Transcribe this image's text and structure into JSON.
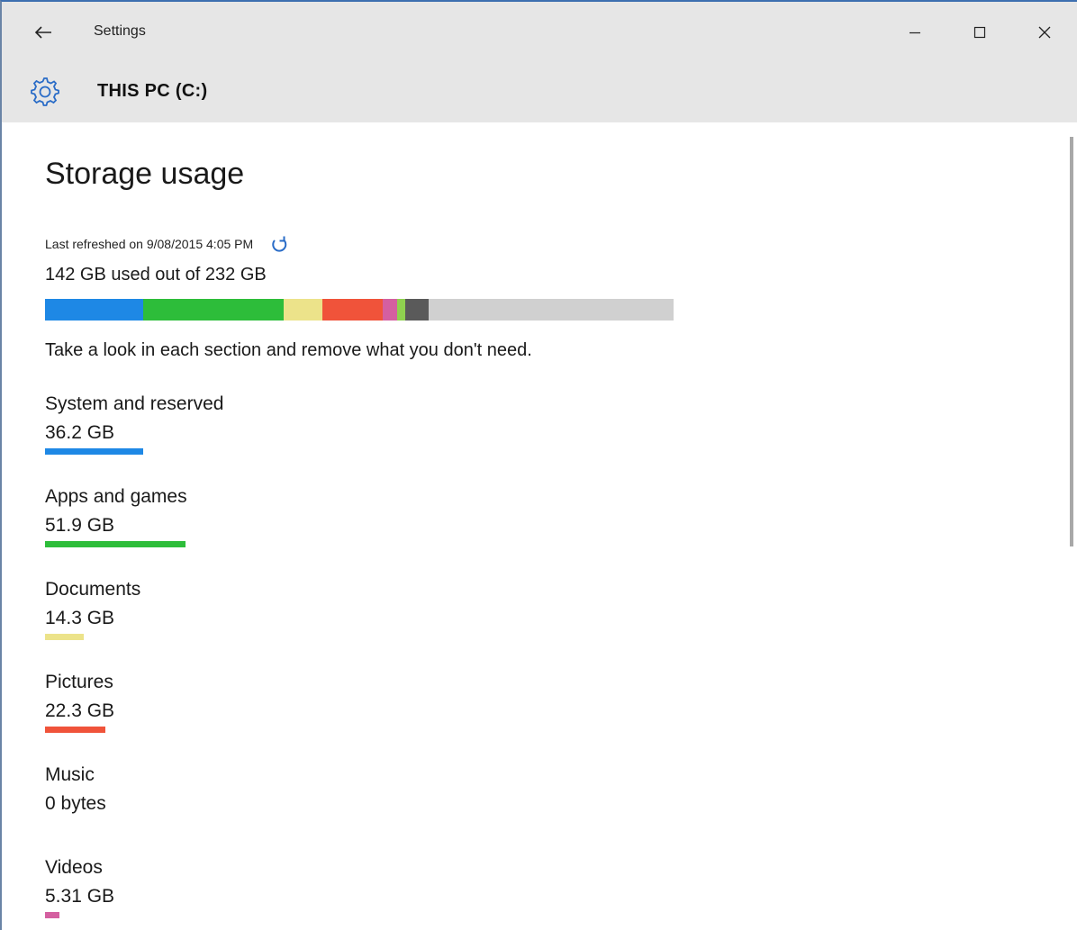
{
  "window": {
    "app_title": "Settings",
    "back_icon": "back-arrow-icon",
    "controls": {
      "minimize_icon": "minimize-icon",
      "maximize_icon": "maximize-icon",
      "close_icon": "close-icon"
    }
  },
  "header": {
    "icon": "gear-icon",
    "title": "THIS PC (C:)"
  },
  "storage": {
    "heading": "Storage usage",
    "last_refreshed": "Last refreshed on 9/08/2015 4:05 PM",
    "refresh_icon": "refresh-icon",
    "used_summary": "142 GB used out of 232 GB",
    "used_gb": 142,
    "total_gb": 232,
    "hint": "Take a look in each section and remove what you don't need.",
    "bar_free_color": "#d0d0d0",
    "bar_segments": [
      {
        "name": "system",
        "value_gb": 36.2,
        "color": "#1e88e5"
      },
      {
        "name": "apps",
        "value_gb": 51.9,
        "color": "#2dbd3a"
      },
      {
        "name": "documents",
        "value_gb": 14.3,
        "color": "#ece38a"
      },
      {
        "name": "pictures",
        "value_gb": 22.3,
        "color": "#f0533a"
      },
      {
        "name": "videos",
        "value_gb": 5.31,
        "color": "#d45fa0"
      },
      {
        "name": "other-green",
        "value_gb": 3.0,
        "color": "#8fd14f"
      },
      {
        "name": "other-dark",
        "value_gb": 8.6,
        "color": "#5a5a5a"
      }
    ],
    "categories": [
      {
        "label": "System and reserved",
        "size": "36.2 GB",
        "value_gb": 36.2,
        "color": "#1e88e5"
      },
      {
        "label": "Apps and games",
        "size": "51.9 GB",
        "value_gb": 51.9,
        "color": "#2dbd3a"
      },
      {
        "label": "Documents",
        "size": "14.3 GB",
        "value_gb": 14.3,
        "color": "#ece38a"
      },
      {
        "label": "Pictures",
        "size": "22.3 GB",
        "value_gb": 22.3,
        "color": "#f0533a"
      },
      {
        "label": "Music",
        "size": "0 bytes",
        "value_gb": 0,
        "color": "#9b59b6"
      },
      {
        "label": "Videos",
        "size": "5.31 GB",
        "value_gb": 5.31,
        "color": "#d45fa0"
      }
    ]
  }
}
